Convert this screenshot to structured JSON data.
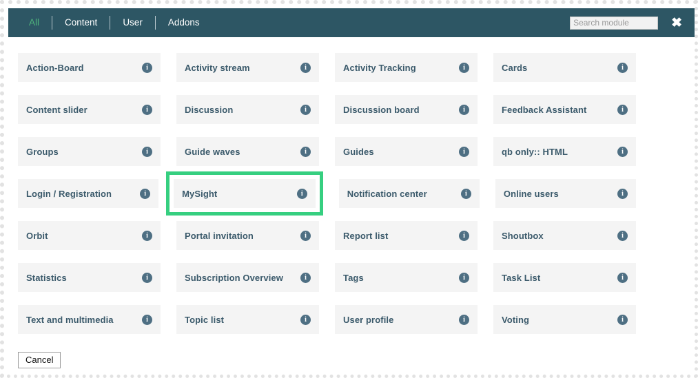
{
  "header": {
    "tabs": [
      {
        "label": "All",
        "active": true
      },
      {
        "label": "Content",
        "active": false
      },
      {
        "label": "User",
        "active": false
      },
      {
        "label": "Addons",
        "active": false
      }
    ],
    "search": {
      "placeholder": "Search module",
      "value": ""
    },
    "close_label": "✖",
    "background_color": "#2d5664",
    "active_tab_color": "#4fb37c"
  },
  "grid": {
    "info_icon_label": "i",
    "selected_module": "MySight",
    "selection_color": "#36cf80",
    "card_background": "#f4f4f4",
    "card_text_color": "#3b5a6b",
    "rows": [
      [
        {
          "label": "Action-Board",
          "selected": false
        },
        {
          "label": "Activity stream",
          "selected": false
        },
        {
          "label": "Activity Tracking",
          "selected": false
        },
        {
          "label": "Cards",
          "selected": false
        }
      ],
      [
        {
          "label": "Content slider",
          "selected": false
        },
        {
          "label": "Discussion",
          "selected": false
        },
        {
          "label": "Discussion board",
          "selected": false
        },
        {
          "label": "Feedback Assistant",
          "selected": false
        }
      ],
      [
        {
          "label": "Groups",
          "selected": false
        },
        {
          "label": "Guide waves",
          "selected": false
        },
        {
          "label": "Guides",
          "selected": false
        },
        {
          "label": "qb only:: HTML",
          "selected": false
        }
      ],
      [
        {
          "label": "Login / Registration",
          "selected": false
        },
        {
          "label": "MySight",
          "selected": true
        },
        {
          "label": "Notification center",
          "selected": false
        },
        {
          "label": "Online users",
          "selected": false
        }
      ],
      [
        {
          "label": "Orbit",
          "selected": false
        },
        {
          "label": "Portal invitation",
          "selected": false
        },
        {
          "label": "Report list",
          "selected": false
        },
        {
          "label": "Shoutbox",
          "selected": false
        }
      ],
      [
        {
          "label": "Statistics",
          "selected": false
        },
        {
          "label": "Subscription Overview",
          "selected": false
        },
        {
          "label": "Tags",
          "selected": false
        },
        {
          "label": "Task List",
          "selected": false
        }
      ],
      [
        {
          "label": "Text and multimedia",
          "selected": false
        },
        {
          "label": "Topic list",
          "selected": false
        },
        {
          "label": "User profile",
          "selected": false
        },
        {
          "label": "Voting",
          "selected": false
        }
      ]
    ]
  },
  "footer": {
    "cancel_label": "Cancel"
  }
}
